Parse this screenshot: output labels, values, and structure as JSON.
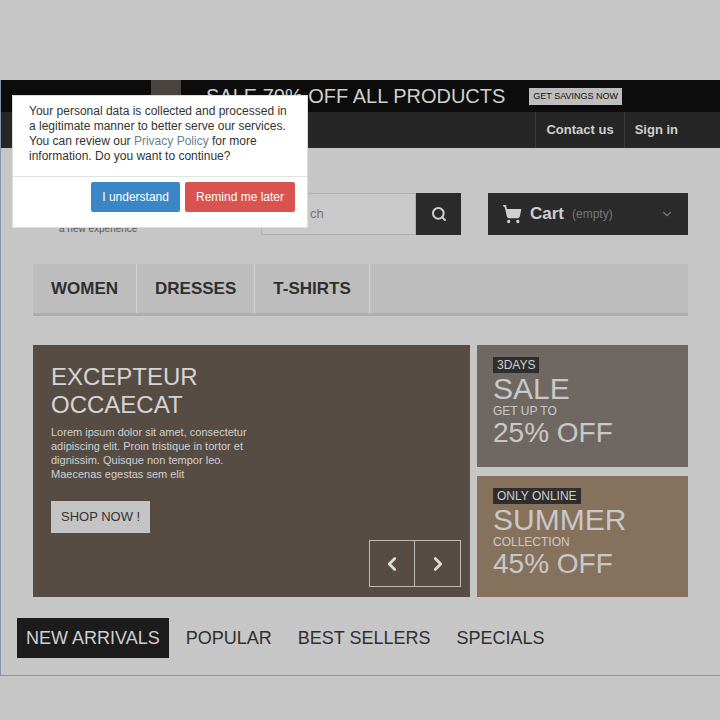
{
  "promo_bar": {
    "text": "SALE 70% OFF ALL PRODUCTS",
    "button": "GET SAVINGS NOW"
  },
  "nav_links": [
    "Contact us",
    "Sign in"
  ],
  "logo": {
    "tagline": "a new experience"
  },
  "search": {
    "placeholder": "ch"
  },
  "cart": {
    "label": "Cart",
    "status": "(empty)"
  },
  "menu": [
    {
      "label": "WOMEN"
    },
    {
      "label": "DRESSES"
    },
    {
      "label": "T-SHIRTS"
    }
  ],
  "slider": {
    "title": "EXCEPTEUR OCCAECAT",
    "text": "Lorem ipsum dolor sit amet, consectetur adipiscing elit. Proin tristique in tortor et dignissim. Quisque non tempor leo. Maecenas egestas sem elit",
    "button": "SHOP NOW !"
  },
  "side_banners": [
    {
      "badge": "3DAYS",
      "headline": "SALE",
      "subline": "GET UP TO",
      "offer": "25% OFF"
    },
    {
      "badge": "ONLY ONLINE",
      "headline": "SUMMER",
      "subline": "COLLECTION",
      "offer": "45% OFF"
    }
  ],
  "product_tabs": [
    {
      "label": "NEW ARRIVALS",
      "selected": true
    },
    {
      "label": "POPULAR",
      "selected": false
    },
    {
      "label": "BEST SELLERS",
      "selected": false
    },
    {
      "label": "SPECIALS",
      "selected": false
    }
  ],
  "cookie_dialog": {
    "text_before": "Your personal data is collected and processed in a legitimate manner to better serve our services. You can review our ",
    "link": "Privacy Policy",
    "text_after": " for more information. Do you want to continue?",
    "buttons": [
      "I understand",
      "Remind me later"
    ]
  }
}
